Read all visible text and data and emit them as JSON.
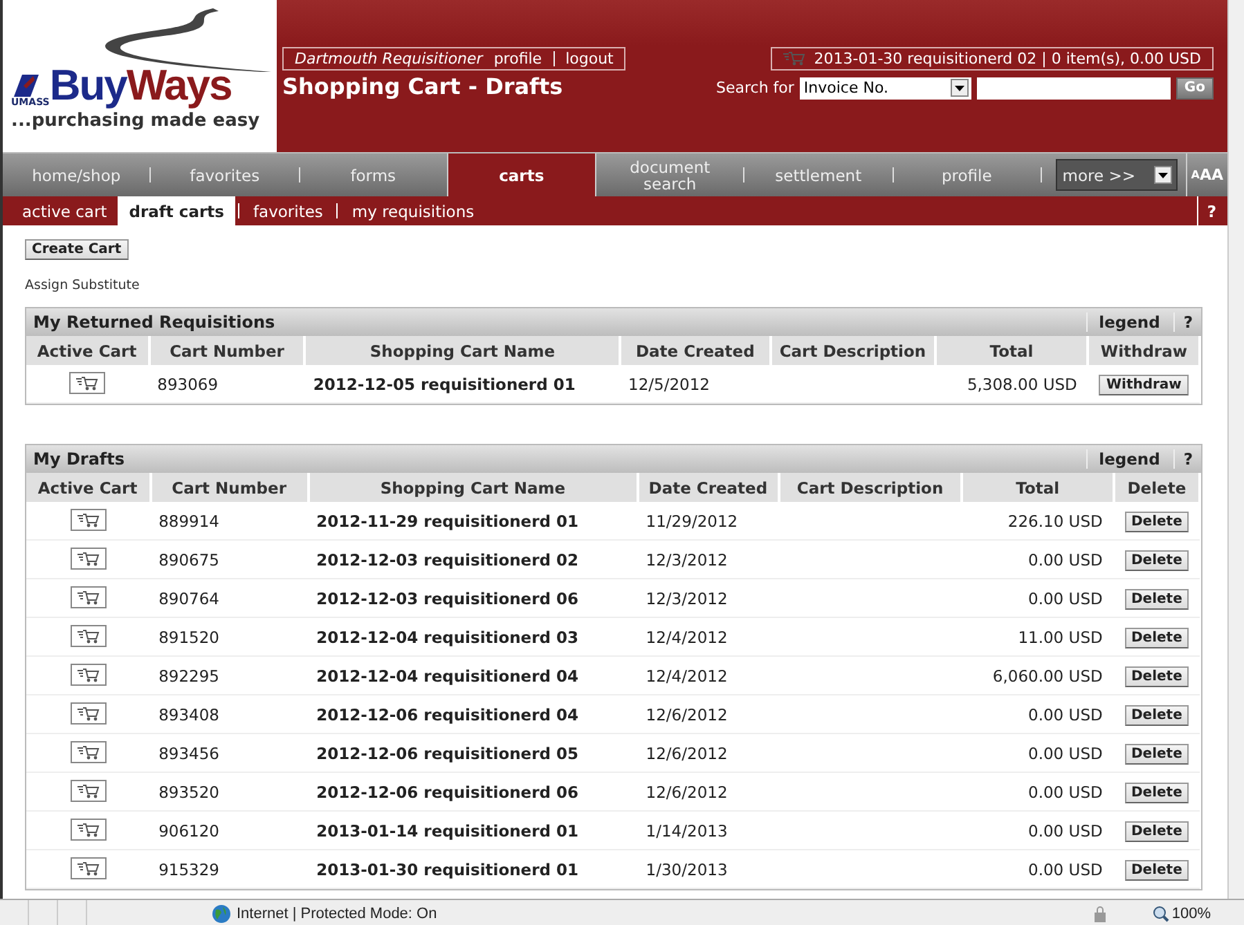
{
  "logo": {
    "brand_first": "Buy",
    "brand_second": "Ways",
    "org": "UMASS",
    "tagline": "...purchasing made easy"
  },
  "user_box": {
    "name": "Dartmouth Requisitioner",
    "links": [
      "profile",
      "logout"
    ]
  },
  "page_title": "Shopping Cart - Drafts",
  "cart_summary": "2013-01-30 requisitionerd 02 | 0 item(s), 0.00 USD",
  "search": {
    "label": "Search for",
    "type_value": "Invoice No.",
    "button": "Go"
  },
  "nav_tabs": [
    {
      "label": "home/shop",
      "selected": false
    },
    {
      "label": "favorites",
      "selected": false
    },
    {
      "label": "forms",
      "selected": false
    },
    {
      "label": "carts",
      "selected": true
    },
    {
      "label": "document search",
      "selected": false
    },
    {
      "label": "settlement",
      "selected": false
    },
    {
      "label": "profile",
      "selected": false
    }
  ],
  "more_menu": "more >>",
  "text_size": "AAA",
  "sub_tabs": [
    {
      "label": "active cart",
      "selected": false
    },
    {
      "label": "draft carts",
      "selected": true
    },
    {
      "label": "favorites",
      "selected": false
    },
    {
      "label": "my requisitions",
      "selected": false
    }
  ],
  "sub_help": "?",
  "create_button": "Create Cart",
  "assign_link": "Assign Substitute",
  "sections": [
    {
      "title": "My Returned Requisitions",
      "legend": "legend",
      "help": "?",
      "columns": [
        "Active Cart",
        "Cart Number",
        "Shopping Cart Name",
        "Date Created",
        "Cart Description",
        "Total",
        "Withdraw"
      ],
      "rows": [
        {
          "number": "893069",
          "name": "2012-12-05 requisitionerd 01",
          "date": "12/5/2012",
          "total": "5,308.00 USD",
          "action": "Withdraw"
        }
      ]
    },
    {
      "title": "My Drafts",
      "legend": "legend",
      "help": "?",
      "columns": [
        "Active Cart",
        "Cart Number",
        "Shopping Cart Name",
        "Date Created",
        "Cart Description",
        "Total",
        "Delete"
      ],
      "rows": [
        {
          "number": "889914",
          "name": "2012-11-29 requisitionerd 01",
          "date": "11/29/2012",
          "total": "226.10 USD",
          "action": "Delete"
        },
        {
          "number": "890675",
          "name": "2012-12-03 requisitionerd 02",
          "date": "12/3/2012",
          "total": "0.00 USD",
          "action": "Delete"
        },
        {
          "number": "890764",
          "name": "2012-12-03 requisitionerd 06",
          "date": "12/3/2012",
          "total": "0.00 USD",
          "action": "Delete"
        },
        {
          "number": "891520",
          "name": "2012-12-04 requisitionerd 03",
          "date": "12/4/2012",
          "total": "11.00 USD",
          "action": "Delete"
        },
        {
          "number": "892295",
          "name": "2012-12-04 requisitionerd 04",
          "date": "12/4/2012",
          "total": "6,060.00 USD",
          "action": "Delete"
        },
        {
          "number": "893408",
          "name": "2012-12-06 requisitionerd 04",
          "date": "12/6/2012",
          "total": "0.00 USD",
          "action": "Delete"
        },
        {
          "number": "893456",
          "name": "2012-12-06 requisitionerd 05",
          "date": "12/6/2012",
          "total": "0.00 USD",
          "action": "Delete"
        },
        {
          "number": "893520",
          "name": "2012-12-06 requisitionerd 06",
          "date": "12/6/2012",
          "total": "0.00 USD",
          "action": "Delete"
        },
        {
          "number": "906120",
          "name": "2013-01-14 requisitionerd 01",
          "date": "1/14/2013",
          "total": "0.00 USD",
          "action": "Delete"
        },
        {
          "number": "915329",
          "name": "2013-01-30 requisitionerd 01",
          "date": "1/30/2013",
          "total": "0.00 USD",
          "action": "Delete"
        }
      ]
    }
  ],
  "status_bar": {
    "zone": "Internet | Protected Mode: On",
    "zoom": "100%"
  }
}
